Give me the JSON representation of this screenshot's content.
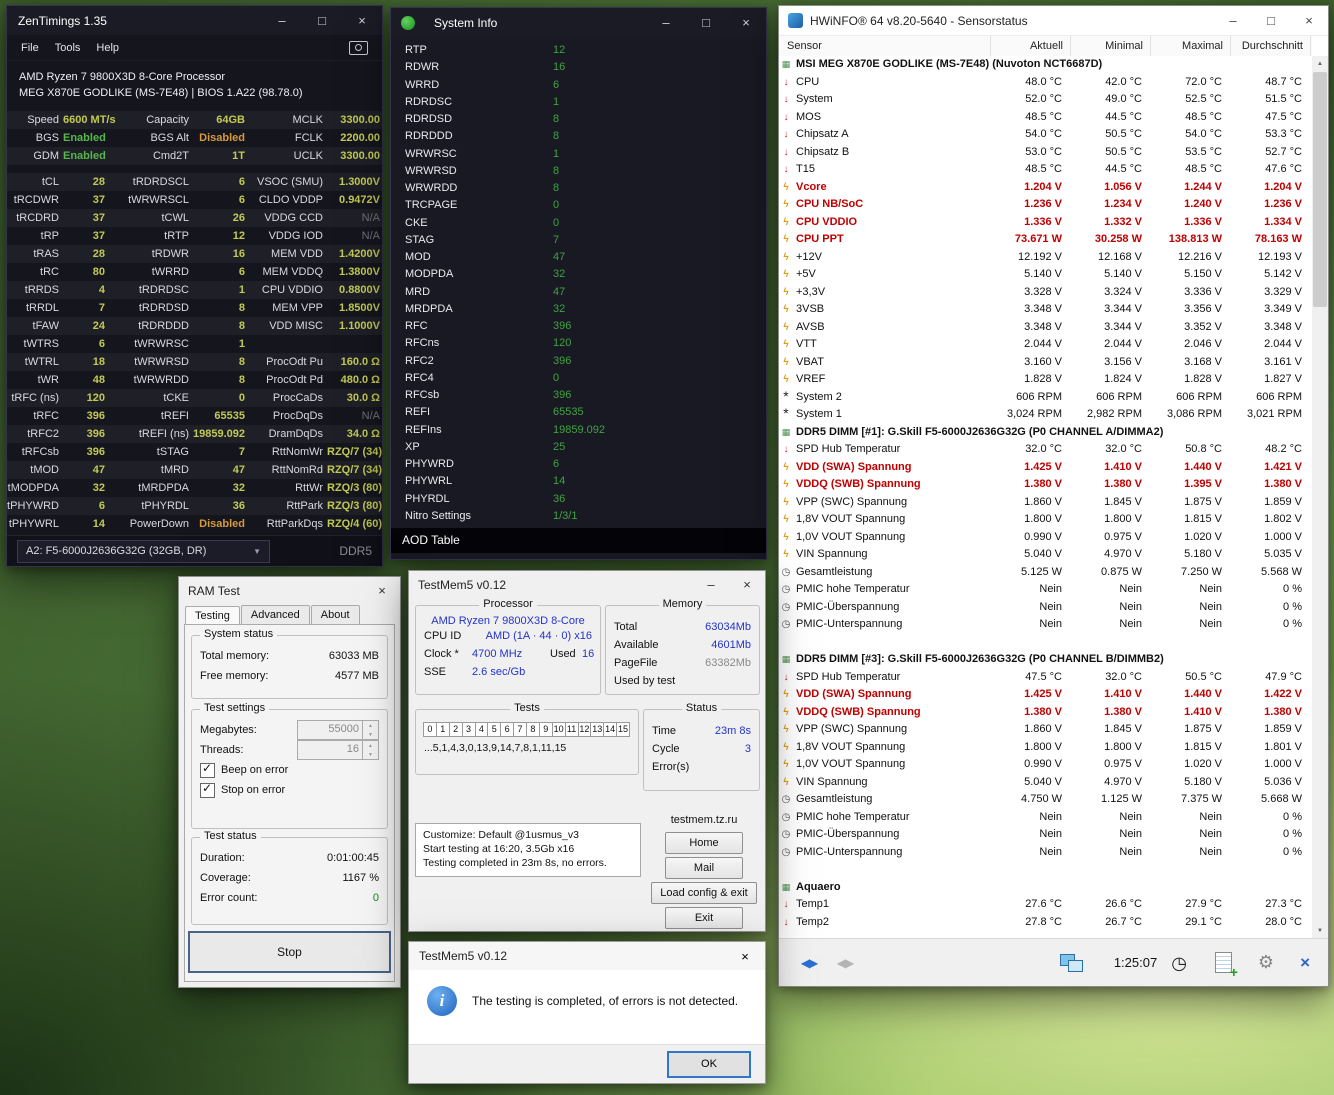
{
  "colors": {
    "zt_value": "#c2ca52",
    "zt_enabled": "#55b84a",
    "zt_disabled": "#d79a3a",
    "si_value": "#3ea43e",
    "hw_alert": "#c00000",
    "tm_value_blue": "#2233cc",
    "focus_accent": "#2f77c9"
  },
  "zentimings": {
    "title": "ZenTimings 1.35",
    "menu": [
      "File",
      "Tools",
      "Help"
    ],
    "cpu_name": "AMD Ryzen 7 9800X3D 8-Core Processor",
    "board": "MEG X870E GODLIKE (MS-7E48) | BIOS 1.A22 (98.78.0)",
    "top_rows": [
      [
        "Speed",
        "6600 MT/s",
        "",
        "Capacity",
        "64GB",
        "",
        "MCLK",
        "3300.00",
        ""
      ],
      [
        "BGS",
        "Enabled",
        "green",
        "BGS Alt",
        "Disabled",
        "orange",
        "FCLK",
        "2200.00",
        ""
      ],
      [
        "GDM",
        "Enabled",
        "green",
        "Cmd2T",
        "1T",
        "",
        "UCLK",
        "3300.00",
        ""
      ]
    ],
    "timing_rows": [
      [
        "tCL",
        "28",
        "",
        "tRDRDSCL",
        "6",
        "",
        "VSOC (SMU)",
        "1.3000V",
        ""
      ],
      [
        "tRCDWR",
        "37",
        "",
        "tWRWRSCL",
        "6",
        "",
        "CLDO VDDP",
        "0.9472V",
        ""
      ],
      [
        "tRCDRD",
        "37",
        "",
        "tCWL",
        "26",
        "",
        "VDDG CCD",
        "N/A",
        "na"
      ],
      [
        "tRP",
        "37",
        "",
        "tRTP",
        "12",
        "",
        "VDDG IOD",
        "N/A",
        "na"
      ],
      [
        "tRAS",
        "28",
        "",
        "tRDWR",
        "16",
        "",
        "MEM VDD",
        "1.4200V",
        ""
      ],
      [
        "tRC",
        "80",
        "",
        "tWRRD",
        "6",
        "",
        "MEM VDDQ",
        "1.3800V",
        ""
      ],
      [
        "tRRDS",
        "4",
        "",
        "tRDRDSC",
        "1",
        "",
        "CPU VDDIO",
        "0.8800V",
        ""
      ],
      [
        "tRRDL",
        "7",
        "",
        "tRDRDSD",
        "8",
        "",
        "MEM VPP",
        "1.8500V",
        ""
      ],
      [
        "tFAW",
        "24",
        "",
        "tRDRDDD",
        "8",
        "",
        "VDD MISC",
        "1.1000V",
        ""
      ],
      [
        "tWTRS",
        "6",
        "",
        "tWRWRSC",
        "1",
        "",
        "",
        "",
        ""
      ],
      [
        "tWTRL",
        "18",
        "",
        "tWRWRSD",
        "8",
        "",
        "ProcOdt Pu",
        "160.0 Ω",
        ""
      ],
      [
        "tWR",
        "48",
        "",
        "tWRWRDD",
        "8",
        "",
        "ProcOdt Pd",
        "480.0 Ω",
        ""
      ],
      [
        "tRFC (ns)",
        "120",
        "",
        "tCKE",
        "0",
        "",
        "ProcCaDs",
        "30.0 Ω",
        ""
      ],
      [
        "tRFC",
        "396",
        "",
        "tREFI",
        "65535",
        "",
        "ProcDqDs",
        "N/A",
        "na"
      ],
      [
        "tRFC2",
        "396",
        "",
        "tREFI (ns)",
        "19859.092",
        "",
        "DramDqDs",
        "34.0 Ω",
        ""
      ],
      [
        "tRFCsb",
        "396",
        "",
        "tSTAG",
        "7",
        "",
        "RttNomWr",
        "RZQ/7 (34)",
        ""
      ],
      [
        "tMOD",
        "47",
        "",
        "tMRD",
        "47",
        "",
        "RttNomRd",
        "RZQ/7 (34)",
        ""
      ],
      [
        "tMODPDA",
        "32",
        "",
        "tMRDPDA",
        "32",
        "",
        "RttWr",
        "RZQ/3 (80)",
        ""
      ],
      [
        "tPHYWRD",
        "6",
        "",
        "tPHYRDL",
        "36",
        "",
        "RttPark",
        "RZQ/3 (80)",
        ""
      ],
      [
        "tPHYWRL",
        "14",
        "",
        "PowerDown",
        "Disabled",
        "orange",
        "RttParkDqs",
        "RZQ/4 (60)",
        ""
      ]
    ],
    "module": "A2: F5-6000J2636G32G (32GB, DR)",
    "ddr": "DDR5"
  },
  "systeminfo": {
    "title": "System Info",
    "rows": [
      [
        "RTP",
        "12"
      ],
      [
        "RDWR",
        "16"
      ],
      [
        "WRRD",
        "6"
      ],
      [
        "RDRDSC",
        "1"
      ],
      [
        "RDRDSD",
        "8"
      ],
      [
        "RDRDDD",
        "8"
      ],
      [
        "WRWRSC",
        "1"
      ],
      [
        "WRWRSD",
        "8"
      ],
      [
        "WRWRDD",
        "8"
      ],
      [
        "TRCPAGE",
        "0"
      ],
      [
        "CKE",
        "0"
      ],
      [
        "STAG",
        "7"
      ],
      [
        "MOD",
        "47"
      ],
      [
        "MODPDA",
        "32"
      ],
      [
        "MRD",
        "47"
      ],
      [
        "MRDPDA",
        "32"
      ],
      [
        "RFC",
        "396"
      ],
      [
        "RFCns",
        "120"
      ],
      [
        "RFC2",
        "396"
      ],
      [
        "RFC4",
        "0"
      ],
      [
        "RFCsb",
        "396"
      ],
      [
        "REFI",
        "65535"
      ],
      [
        "REFIns",
        "19859.092"
      ],
      [
        "XP",
        "25"
      ],
      [
        "PHYWRD",
        "6"
      ],
      [
        "PHYWRL",
        "14"
      ],
      [
        "PHYRDL",
        "36"
      ],
      [
        "Nitro Settings",
        "1/3/1"
      ]
    ],
    "footer": "AOD Table"
  },
  "hwinfo": {
    "title": "HWiNFO® 64 v8.20-5640 - Sensorstatus",
    "columns": [
      "Sensor",
      "Aktuell",
      "Minimal",
      "Maximal",
      "Durchschnitt"
    ],
    "clock": "1:25:07",
    "rows": [
      {
        "t": "section",
        "icon": "chip",
        "name": "MSI MEG X870E GODLIKE (MS-7E48) (Nuvoton NCT6687D)"
      },
      {
        "t": "row",
        "icon": "temp",
        "name": "CPU",
        "v": [
          "48.0 °C",
          "42.0 °C",
          "72.0 °C",
          "48.7 °C"
        ]
      },
      {
        "t": "row",
        "icon": "temp",
        "name": "System",
        "v": [
          "52.0 °C",
          "49.0 °C",
          "52.5 °C",
          "51.5 °C"
        ]
      },
      {
        "t": "row",
        "icon": "temp",
        "name": "MOS",
        "v": [
          "48.5 °C",
          "44.5 °C",
          "48.5 °C",
          "47.5 °C"
        ]
      },
      {
        "t": "row",
        "icon": "temp",
        "name": "Chipsatz A",
        "v": [
          "54.0 °C",
          "50.5 °C",
          "54.0 °C",
          "53.3 °C"
        ]
      },
      {
        "t": "row",
        "icon": "temp",
        "name": "Chipsatz B",
        "v": [
          "53.0 °C",
          "50.5 °C",
          "53.5 °C",
          "52.7 °C"
        ]
      },
      {
        "t": "row",
        "icon": "temp",
        "name": "T15",
        "v": [
          "48.5 °C",
          "44.5 °C",
          "48.5 °C",
          "47.6 °C"
        ]
      },
      {
        "t": "row",
        "icon": "volt",
        "red": true,
        "name": "Vcore",
        "v": [
          "1.204 V",
          "1.056 V",
          "1.244 V",
          "1.204 V"
        ]
      },
      {
        "t": "row",
        "icon": "volt",
        "red": true,
        "name": "CPU NB/SoC",
        "v": [
          "1.236 V",
          "1.234 V",
          "1.240 V",
          "1.236 V"
        ]
      },
      {
        "t": "row",
        "icon": "volt",
        "red": true,
        "name": "CPU VDDIO",
        "v": [
          "1.336 V",
          "1.332 V",
          "1.336 V",
          "1.334 V"
        ]
      },
      {
        "t": "row",
        "icon": "volt",
        "red": true,
        "name": "CPU PPT",
        "v": [
          "73.671 W",
          "30.258 W",
          "138.813 W",
          "78.163 W"
        ]
      },
      {
        "t": "row",
        "icon": "volt",
        "name": "+12V",
        "v": [
          "12.192 V",
          "12.168 V",
          "12.216 V",
          "12.193 V"
        ]
      },
      {
        "t": "row",
        "icon": "volt",
        "name": "+5V",
        "v": [
          "5.140 V",
          "5.140 V",
          "5.150 V",
          "5.142 V"
        ]
      },
      {
        "t": "row",
        "icon": "volt",
        "name": "+3,3V",
        "v": [
          "3.328 V",
          "3.324 V",
          "3.336 V",
          "3.329 V"
        ]
      },
      {
        "t": "row",
        "icon": "volt",
        "name": "3VSB",
        "v": [
          "3.348 V",
          "3.344 V",
          "3.356 V",
          "3.349 V"
        ]
      },
      {
        "t": "row",
        "icon": "volt",
        "name": "AVSB",
        "v": [
          "3.348 V",
          "3.344 V",
          "3.352 V",
          "3.348 V"
        ]
      },
      {
        "t": "row",
        "icon": "volt",
        "name": "VTT",
        "v": [
          "2.044 V",
          "2.044 V",
          "2.046 V",
          "2.044 V"
        ]
      },
      {
        "t": "row",
        "icon": "volt",
        "name": "VBAT",
        "v": [
          "3.160 V",
          "3.156 V",
          "3.168 V",
          "3.161 V"
        ]
      },
      {
        "t": "row",
        "icon": "volt",
        "name": "VREF",
        "v": [
          "1.828 V",
          "1.824 V",
          "1.828 V",
          "1.827 V"
        ]
      },
      {
        "t": "row",
        "icon": "fan",
        "name": "System 2",
        "v": [
          "606 RPM",
          "606 RPM",
          "606 RPM",
          "606 RPM"
        ]
      },
      {
        "t": "row",
        "icon": "fan",
        "name": "System 1",
        "v": [
          "3,024 RPM",
          "2,982 RPM",
          "3,086 RPM",
          "3,021 RPM"
        ]
      },
      {
        "t": "section",
        "icon": "ram",
        "name": "DDR5 DIMM [#1]: G.Skill F5-6000J2636G32G (P0 CHANNEL A/DIMMA2)"
      },
      {
        "t": "row",
        "icon": "temp",
        "name": "SPD Hub Temperatur",
        "v": [
          "32.0 °C",
          "32.0 °C",
          "50.8 °C",
          "48.2 °C"
        ]
      },
      {
        "t": "row",
        "icon": "volt",
        "red": true,
        "name": "VDD (SWA) Spannung",
        "v": [
          "1.425 V",
          "1.410 V",
          "1.440 V",
          "1.421 V"
        ]
      },
      {
        "t": "row",
        "icon": "volt",
        "red": true,
        "name": "VDDQ (SWB) Spannung",
        "v": [
          "1.380 V",
          "1.380 V",
          "1.395 V",
          "1.380 V"
        ]
      },
      {
        "t": "row",
        "icon": "volt",
        "name": "VPP (SWC) Spannung",
        "v": [
          "1.860 V",
          "1.845 V",
          "1.875 V",
          "1.859 V"
        ]
      },
      {
        "t": "row",
        "icon": "volt",
        "name": "1,8V VOUT Spannung",
        "v": [
          "1.800 V",
          "1.800 V",
          "1.815 V",
          "1.802 V"
        ]
      },
      {
        "t": "row",
        "icon": "volt",
        "name": "1,0V VOUT Spannung",
        "v": [
          "0.990 V",
          "0.975 V",
          "1.020 V",
          "1.000 V"
        ]
      },
      {
        "t": "row",
        "icon": "volt",
        "name": "VIN Spannung",
        "v": [
          "5.040 V",
          "4.970 V",
          "5.180 V",
          "5.035 V"
        ]
      },
      {
        "t": "row",
        "icon": "clock",
        "name": "Gesamtleistung",
        "v": [
          "5.125 W",
          "0.875 W",
          "7.250 W",
          "5.568 W"
        ]
      },
      {
        "t": "row",
        "icon": "clock",
        "name": "PMIC hohe Temperatur",
        "v": [
          "Nein",
          "Nein",
          "Nein",
          "0 %"
        ]
      },
      {
        "t": "row",
        "icon": "clock",
        "name": "PMIC-Überspannung",
        "v": [
          "Nein",
          "Nein",
          "Nein",
          "0 %"
        ]
      },
      {
        "t": "row",
        "icon": "clock",
        "name": "PMIC-Unterspannung",
        "v": [
          "Nein",
          "Nein",
          "Nein",
          "0 %"
        ]
      },
      {
        "t": "gap"
      },
      {
        "t": "section",
        "icon": "ram",
        "name": "DDR5 DIMM [#3]: G.Skill F5-6000J2636G32G (P0 CHANNEL B/DIMMB2)"
      },
      {
        "t": "row",
        "icon": "temp",
        "name": "SPD Hub Temperatur",
        "v": [
          "47.5 °C",
          "32.0 °C",
          "50.5 °C",
          "47.9 °C"
        ]
      },
      {
        "t": "row",
        "icon": "volt",
        "red": true,
        "name": "VDD (SWA) Spannung",
        "v": [
          "1.425 V",
          "1.410 V",
          "1.440 V",
          "1.422 V"
        ]
      },
      {
        "t": "row",
        "icon": "volt",
        "red": true,
        "name": "VDDQ (SWB) Spannung",
        "v": [
          "1.380 V",
          "1.380 V",
          "1.410 V",
          "1.380 V"
        ]
      },
      {
        "t": "row",
        "icon": "volt",
        "name": "VPP (SWC) Spannung",
        "v": [
          "1.860 V",
          "1.845 V",
          "1.875 V",
          "1.859 V"
        ]
      },
      {
        "t": "row",
        "icon": "volt",
        "name": "1,8V VOUT Spannung",
        "v": [
          "1.800 V",
          "1.800 V",
          "1.815 V",
          "1.801 V"
        ]
      },
      {
        "t": "row",
        "icon": "volt",
        "name": "1,0V VOUT Spannung",
        "v": [
          "0.990 V",
          "0.975 V",
          "1.020 V",
          "1.000 V"
        ]
      },
      {
        "t": "row",
        "icon": "volt",
        "name": "VIN Spannung",
        "v": [
          "5.040 V",
          "4.970 V",
          "5.180 V",
          "5.036 V"
        ]
      },
      {
        "t": "row",
        "icon": "clock",
        "name": "Gesamtleistung",
        "v": [
          "4.750 W",
          "1.125 W",
          "7.375 W",
          "5.668 W"
        ]
      },
      {
        "t": "row",
        "icon": "clock",
        "name": "PMIC hohe Temperatur",
        "v": [
          "Nein",
          "Nein",
          "Nein",
          "0 %"
        ]
      },
      {
        "t": "row",
        "icon": "clock",
        "name": "PMIC-Überspannung",
        "v": [
          "Nein",
          "Nein",
          "Nein",
          "0 %"
        ]
      },
      {
        "t": "row",
        "icon": "clock",
        "name": "PMIC-Unterspannung",
        "v": [
          "Nein",
          "Nein",
          "Nein",
          "0 %"
        ]
      },
      {
        "t": "gap"
      },
      {
        "t": "section",
        "icon": "chip",
        "name": "Aquaero"
      },
      {
        "t": "row",
        "icon": "temp",
        "name": "Temp1",
        "v": [
          "27.6 °C",
          "26.6 °C",
          "27.9 °C",
          "27.3 °C"
        ]
      },
      {
        "t": "row",
        "icon": "temp",
        "name": "Temp2",
        "v": [
          "27.8 °C",
          "26.7 °C",
          "29.1 °C",
          "28.0 °C"
        ]
      }
    ]
  },
  "ramtest": {
    "title": "RAM Test",
    "tabs": [
      "Testing",
      "Advanced",
      "About"
    ],
    "groups": {
      "system_status": {
        "label": "System status",
        "rows": [
          [
            "Total memory:",
            "63033 MB"
          ],
          [
            "Free memory:",
            "4577 MB"
          ]
        ]
      },
      "test_settings": {
        "label": "Test settings",
        "spin_rows": [
          [
            "Megabytes:",
            "55000"
          ],
          [
            "Threads:",
            "16"
          ]
        ],
        "checks": [
          "Beep on error",
          "Stop on error"
        ]
      },
      "test_status": {
        "label": "Test status",
        "rows": [
          [
            "Duration:",
            "0:01:00:45"
          ],
          [
            "Coverage:",
            "1167 %"
          ],
          [
            "Error count:",
            "0",
            "green"
          ]
        ]
      }
    },
    "stop_button": "Stop"
  },
  "testmem5": {
    "title": "TestMem5 v0.12",
    "processor": {
      "label": "Processor",
      "name": "AMD Ryzen 7 9800X3D 8-Core",
      "cpu_id_label": "CPU ID",
      "cpu_id": "AMD (1A · 44 · 0) x16",
      "clock_label": "Clock *",
      "clock": "4700 MHz",
      "used_label": "Used",
      "used": "16",
      "sse_label": "SSE",
      "s_value": "2.6 sec/Gb"
    },
    "memory": {
      "label": "Memory",
      "rows": [
        [
          "Total",
          "63034Mb",
          "blue"
        ],
        [
          "Available",
          "4601Mb",
          "blue"
        ],
        [
          "PageFile",
          "63382Mb",
          "gray"
        ],
        [
          "Used by test",
          "",
          ""
        ]
      ]
    },
    "tests": {
      "label": "Tests",
      "cells": [
        "0",
        "1",
        "2",
        "3",
        "4",
        "5",
        "6",
        "7",
        "8",
        "9",
        "10",
        "11",
        "12",
        "13",
        "14",
        "15"
      ],
      "sequence": "...5,1,4,3,0,13,9,14,7,8,1,11,15"
    },
    "status": {
      "label": "Status",
      "rows": [
        [
          "Time",
          "23m 8s"
        ],
        [
          "Cycle",
          "3"
        ],
        [
          "Error(s)",
          ""
        ]
      ]
    },
    "info_lines": [
      "Customize: Default @1usmus_v3",
      "Start testing at 16:20, 3.5Gb x16",
      "Testing completed in 23m 8s, no errors."
    ],
    "site": "testmem.tz.ru",
    "buttons": [
      "Home",
      "Mail",
      "Load config & exit",
      "Exit"
    ]
  },
  "dialog": {
    "title": "TestMem5 v0.12",
    "message": "The testing is completed, of errors is not detected.",
    "ok": "OK"
  }
}
